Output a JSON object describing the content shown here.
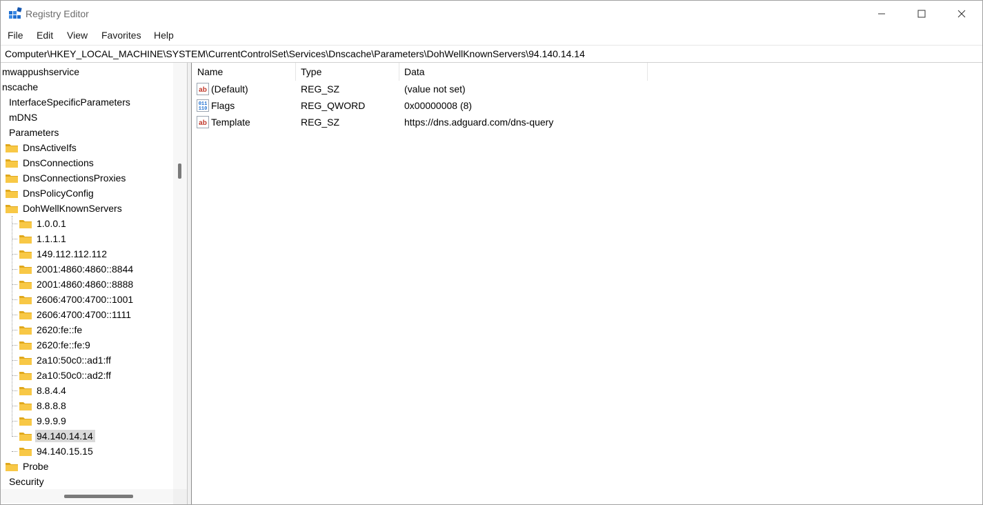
{
  "window": {
    "title": "Registry Editor",
    "controls": {
      "minimize": "minimize",
      "maximize": "maximize",
      "close": "close"
    }
  },
  "menu": [
    "File",
    "Edit",
    "View",
    "Favorites",
    "Help"
  ],
  "address": "Computer\\HKEY_LOCAL_MACHINE\\SYSTEM\\CurrentControlSet\\Services\\Dnscache\\Parameters\\DohWellKnownServers\\94.140.14.14",
  "tree": [
    {
      "label": "mwappushservice",
      "folder": false,
      "selected": false
    },
    {
      "label": "nscache",
      "folder": false,
      "selected": false
    },
    {
      "label": "InterfaceSpecificParameters",
      "folder": false,
      "selected": false
    },
    {
      "label": "mDNS",
      "folder": false,
      "selected": false
    },
    {
      "label": "Parameters",
      "folder": false,
      "selected": false
    },
    {
      "label": "DnsActiveIfs",
      "folder": true,
      "selected": false
    },
    {
      "label": "DnsConnections",
      "folder": true,
      "selected": false
    },
    {
      "label": "DnsConnectionsProxies",
      "folder": true,
      "selected": false
    },
    {
      "label": "DnsPolicyConfig",
      "folder": true,
      "selected": false
    },
    {
      "label": "DohWellKnownServers",
      "folder": true,
      "selected": false
    },
    {
      "label": "1.0.0.1",
      "folder": true,
      "selected": false
    },
    {
      "label": "1.1.1.1",
      "folder": true,
      "selected": false
    },
    {
      "label": "149.112.112.112",
      "folder": true,
      "selected": false
    },
    {
      "label": "2001:4860:4860::8844",
      "folder": true,
      "selected": false
    },
    {
      "label": "2001:4860:4860::8888",
      "folder": true,
      "selected": false
    },
    {
      "label": "2606:4700:4700::1001",
      "folder": true,
      "selected": false
    },
    {
      "label": "2606:4700:4700::1111",
      "folder": true,
      "selected": false
    },
    {
      "label": "2620:fe::fe",
      "folder": true,
      "selected": false
    },
    {
      "label": "2620:fe::fe:9",
      "folder": true,
      "selected": false
    },
    {
      "label": "2a10:50c0::ad1:ff",
      "folder": true,
      "selected": false
    },
    {
      "label": "2a10:50c0::ad2:ff",
      "folder": true,
      "selected": false
    },
    {
      "label": "8.8.4.4",
      "folder": true,
      "selected": false
    },
    {
      "label": "8.8.8.8",
      "folder": true,
      "selected": false
    },
    {
      "label": "9.9.9.9",
      "folder": true,
      "selected": false
    },
    {
      "label": "94.140.14.14",
      "folder": true,
      "selected": true
    },
    {
      "label": "94.140.15.15",
      "folder": true,
      "selected": false
    },
    {
      "label": "Probe",
      "folder": true,
      "selected": false
    },
    {
      "label": "Security",
      "folder": false,
      "selected": false
    }
  ],
  "columns": [
    "Name",
    "Type",
    "Data"
  ],
  "values": [
    {
      "icon": "string-value-icon",
      "name": "(Default)",
      "type": "REG_SZ",
      "data": "(value not set)"
    },
    {
      "icon": "binary-value-icon",
      "name": "Flags",
      "type": "REG_QWORD",
      "data": "0x00000008 (8)"
    },
    {
      "icon": "string-value-icon",
      "name": "Template",
      "type": "REG_SZ",
      "data": "https://dns.adguard.com/dns-query"
    }
  ],
  "colors": {
    "folder": "#f8c846",
    "folder_dark": "#e0a81c",
    "selection": "#d9d9d9",
    "icon_blue": "#1f6fd0"
  }
}
